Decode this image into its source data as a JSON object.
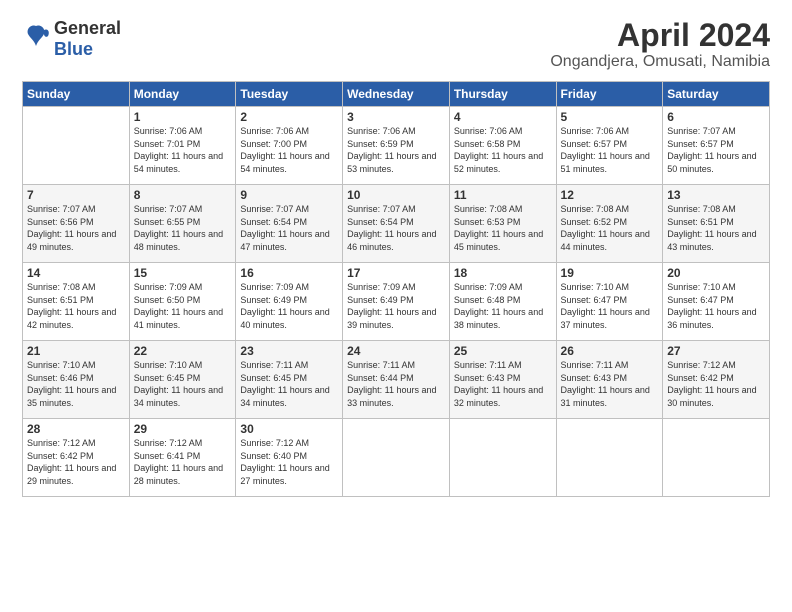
{
  "header": {
    "logo_general": "General",
    "logo_blue": "Blue",
    "title": "April 2024",
    "subtitle": "Ongandjera, Omusati, Namibia"
  },
  "weekdays": [
    "Sunday",
    "Monday",
    "Tuesday",
    "Wednesday",
    "Thursday",
    "Friday",
    "Saturday"
  ],
  "weeks": [
    [
      {
        "day": "",
        "sunrise": "",
        "sunset": "",
        "daylight": ""
      },
      {
        "day": "1",
        "sunrise": "Sunrise: 7:06 AM",
        "sunset": "Sunset: 7:01 PM",
        "daylight": "Daylight: 11 hours and 54 minutes."
      },
      {
        "day": "2",
        "sunrise": "Sunrise: 7:06 AM",
        "sunset": "Sunset: 7:00 PM",
        "daylight": "Daylight: 11 hours and 54 minutes."
      },
      {
        "day": "3",
        "sunrise": "Sunrise: 7:06 AM",
        "sunset": "Sunset: 6:59 PM",
        "daylight": "Daylight: 11 hours and 53 minutes."
      },
      {
        "day": "4",
        "sunrise": "Sunrise: 7:06 AM",
        "sunset": "Sunset: 6:58 PM",
        "daylight": "Daylight: 11 hours and 52 minutes."
      },
      {
        "day": "5",
        "sunrise": "Sunrise: 7:06 AM",
        "sunset": "Sunset: 6:57 PM",
        "daylight": "Daylight: 11 hours and 51 minutes."
      },
      {
        "day": "6",
        "sunrise": "Sunrise: 7:07 AM",
        "sunset": "Sunset: 6:57 PM",
        "daylight": "Daylight: 11 hours and 50 minutes."
      }
    ],
    [
      {
        "day": "7",
        "sunrise": "Sunrise: 7:07 AM",
        "sunset": "Sunset: 6:56 PM",
        "daylight": "Daylight: 11 hours and 49 minutes."
      },
      {
        "day": "8",
        "sunrise": "Sunrise: 7:07 AM",
        "sunset": "Sunset: 6:55 PM",
        "daylight": "Daylight: 11 hours and 48 minutes."
      },
      {
        "day": "9",
        "sunrise": "Sunrise: 7:07 AM",
        "sunset": "Sunset: 6:54 PM",
        "daylight": "Daylight: 11 hours and 47 minutes."
      },
      {
        "day": "10",
        "sunrise": "Sunrise: 7:07 AM",
        "sunset": "Sunset: 6:54 PM",
        "daylight": "Daylight: 11 hours and 46 minutes."
      },
      {
        "day": "11",
        "sunrise": "Sunrise: 7:08 AM",
        "sunset": "Sunset: 6:53 PM",
        "daylight": "Daylight: 11 hours and 45 minutes."
      },
      {
        "day": "12",
        "sunrise": "Sunrise: 7:08 AM",
        "sunset": "Sunset: 6:52 PM",
        "daylight": "Daylight: 11 hours and 44 minutes."
      },
      {
        "day": "13",
        "sunrise": "Sunrise: 7:08 AM",
        "sunset": "Sunset: 6:51 PM",
        "daylight": "Daylight: 11 hours and 43 minutes."
      }
    ],
    [
      {
        "day": "14",
        "sunrise": "Sunrise: 7:08 AM",
        "sunset": "Sunset: 6:51 PM",
        "daylight": "Daylight: 11 hours and 42 minutes."
      },
      {
        "day": "15",
        "sunrise": "Sunrise: 7:09 AM",
        "sunset": "Sunset: 6:50 PM",
        "daylight": "Daylight: 11 hours and 41 minutes."
      },
      {
        "day": "16",
        "sunrise": "Sunrise: 7:09 AM",
        "sunset": "Sunset: 6:49 PM",
        "daylight": "Daylight: 11 hours and 40 minutes."
      },
      {
        "day": "17",
        "sunrise": "Sunrise: 7:09 AM",
        "sunset": "Sunset: 6:49 PM",
        "daylight": "Daylight: 11 hours and 39 minutes."
      },
      {
        "day": "18",
        "sunrise": "Sunrise: 7:09 AM",
        "sunset": "Sunset: 6:48 PM",
        "daylight": "Daylight: 11 hours and 38 minutes."
      },
      {
        "day": "19",
        "sunrise": "Sunrise: 7:10 AM",
        "sunset": "Sunset: 6:47 PM",
        "daylight": "Daylight: 11 hours and 37 minutes."
      },
      {
        "day": "20",
        "sunrise": "Sunrise: 7:10 AM",
        "sunset": "Sunset: 6:47 PM",
        "daylight": "Daylight: 11 hours and 36 minutes."
      }
    ],
    [
      {
        "day": "21",
        "sunrise": "Sunrise: 7:10 AM",
        "sunset": "Sunset: 6:46 PM",
        "daylight": "Daylight: 11 hours and 35 minutes."
      },
      {
        "day": "22",
        "sunrise": "Sunrise: 7:10 AM",
        "sunset": "Sunset: 6:45 PM",
        "daylight": "Daylight: 11 hours and 34 minutes."
      },
      {
        "day": "23",
        "sunrise": "Sunrise: 7:11 AM",
        "sunset": "Sunset: 6:45 PM",
        "daylight": "Daylight: 11 hours and 34 minutes."
      },
      {
        "day": "24",
        "sunrise": "Sunrise: 7:11 AM",
        "sunset": "Sunset: 6:44 PM",
        "daylight": "Daylight: 11 hours and 33 minutes."
      },
      {
        "day": "25",
        "sunrise": "Sunrise: 7:11 AM",
        "sunset": "Sunset: 6:43 PM",
        "daylight": "Daylight: 11 hours and 32 minutes."
      },
      {
        "day": "26",
        "sunrise": "Sunrise: 7:11 AM",
        "sunset": "Sunset: 6:43 PM",
        "daylight": "Daylight: 11 hours and 31 minutes."
      },
      {
        "day": "27",
        "sunrise": "Sunrise: 7:12 AM",
        "sunset": "Sunset: 6:42 PM",
        "daylight": "Daylight: 11 hours and 30 minutes."
      }
    ],
    [
      {
        "day": "28",
        "sunrise": "Sunrise: 7:12 AM",
        "sunset": "Sunset: 6:42 PM",
        "daylight": "Daylight: 11 hours and 29 minutes."
      },
      {
        "day": "29",
        "sunrise": "Sunrise: 7:12 AM",
        "sunset": "Sunset: 6:41 PM",
        "daylight": "Daylight: 11 hours and 28 minutes."
      },
      {
        "day": "30",
        "sunrise": "Sunrise: 7:12 AM",
        "sunset": "Sunset: 6:40 PM",
        "daylight": "Daylight: 11 hours and 27 minutes."
      },
      {
        "day": "",
        "sunrise": "",
        "sunset": "",
        "daylight": ""
      },
      {
        "day": "",
        "sunrise": "",
        "sunset": "",
        "daylight": ""
      },
      {
        "day": "",
        "sunrise": "",
        "sunset": "",
        "daylight": ""
      },
      {
        "day": "",
        "sunrise": "",
        "sunset": "",
        "daylight": ""
      }
    ]
  ]
}
